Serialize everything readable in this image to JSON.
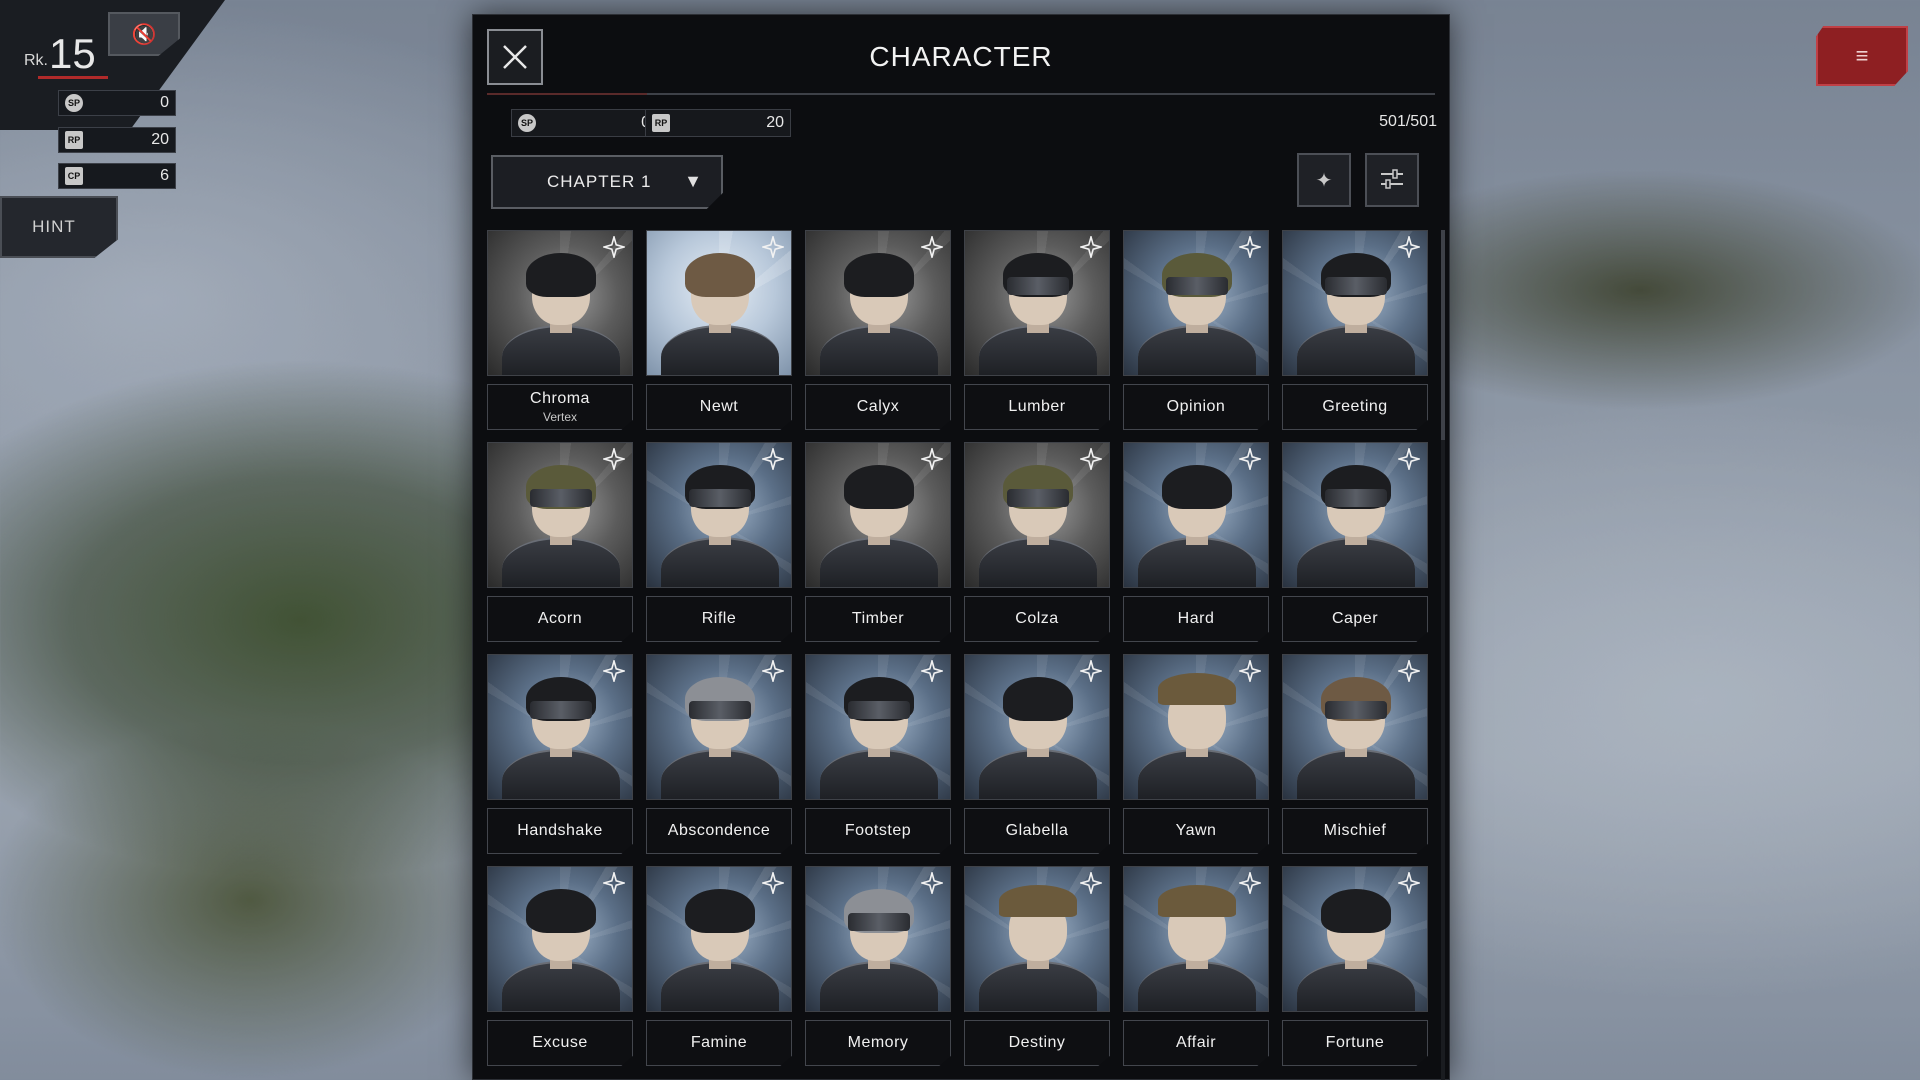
{
  "hud": {
    "rank_prefix": "Rk.",
    "rank_value": "15",
    "resources": [
      {
        "icon": "SP",
        "value": "0"
      },
      {
        "icon": "RP",
        "value": "20"
      },
      {
        "icon": "CP",
        "value": "6"
      }
    ],
    "hint_label": "HINT",
    "menu_icon": "≡",
    "mute_icon": "🔇"
  },
  "modal": {
    "title": "CHARACTER",
    "close_icon": "close-x",
    "sp_label": "SP",
    "sp_value": "0",
    "rp_label": "RP",
    "rp_value": "20",
    "count": "501/501",
    "chapter": "CHAPTER 1",
    "chapter_caret": "▼",
    "favorite_filter_icon": "✦",
    "sort_icon": "≡"
  },
  "characters": [
    {
      "name": "Chroma",
      "sub": "Vertex"
    },
    {
      "name": "Newt",
      "sub": ""
    },
    {
      "name": "Calyx",
      "sub": ""
    },
    {
      "name": "Lumber",
      "sub": ""
    },
    {
      "name": "Opinion",
      "sub": ""
    },
    {
      "name": "Greeting",
      "sub": ""
    },
    {
      "name": "Acorn",
      "sub": ""
    },
    {
      "name": "Rifle",
      "sub": ""
    },
    {
      "name": "Timber",
      "sub": ""
    },
    {
      "name": "Colza",
      "sub": ""
    },
    {
      "name": "Hard",
      "sub": ""
    },
    {
      "name": "Caper",
      "sub": ""
    },
    {
      "name": "Handshake",
      "sub": ""
    },
    {
      "name": "Abscondence",
      "sub": ""
    },
    {
      "name": "Footstep",
      "sub": ""
    },
    {
      "name": "Glabella",
      "sub": ""
    },
    {
      "name": "Yawn",
      "sub": ""
    },
    {
      "name": "Mischief",
      "sub": ""
    },
    {
      "name": "Excuse",
      "sub": ""
    },
    {
      "name": "Famine",
      "sub": ""
    },
    {
      "name": "Memory",
      "sub": ""
    },
    {
      "name": "Destiny",
      "sub": ""
    },
    {
      "name": "Affair",
      "sub": ""
    },
    {
      "name": "Fortune",
      "sub": ""
    }
  ]
}
